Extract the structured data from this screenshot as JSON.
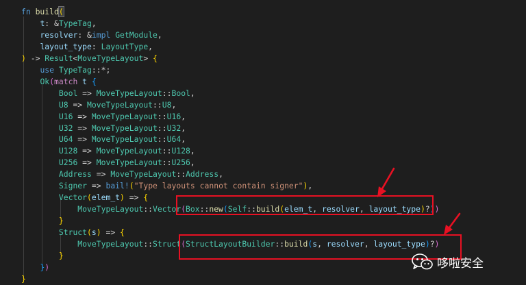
{
  "colors": {
    "background": "#1e1e1e",
    "keyword": "#569cd6",
    "control_keyword": "#c586c0",
    "type": "#4ec9b0",
    "function": "#dcdcaa",
    "variable": "#9cdcfe",
    "string": "#ce9178",
    "plain": "#d4d4d4",
    "bracket_level1": "#ffd700",
    "bracket_level2": "#da70d6",
    "bracket_level3": "#179fff",
    "annotation_red": "#e81123"
  },
  "code_lines": [
    [
      [
        "kw",
        "fn"
      ],
      [
        "pl",
        " "
      ],
      [
        "fn",
        "build"
      ],
      [
        "cur",
        "("
      ]
    ],
    [
      [
        "pl",
        "    "
      ],
      [
        "var",
        "t"
      ],
      [
        "pl",
        ": &"
      ],
      [
        "type",
        "TypeTag"
      ],
      [
        "pl",
        ","
      ]
    ],
    [
      [
        "pl",
        "    "
      ],
      [
        "var",
        "resolver"
      ],
      [
        "pl",
        ": &"
      ],
      [
        "kw",
        "impl"
      ],
      [
        "pl",
        " "
      ],
      [
        "type",
        "GetModule"
      ],
      [
        "pl",
        ","
      ]
    ],
    [
      [
        "pl",
        "    "
      ],
      [
        "var",
        "layout_type"
      ],
      [
        "pl",
        ": "
      ],
      [
        "type",
        "LayoutType"
      ],
      [
        "pl",
        ","
      ]
    ],
    [
      [
        "p1",
        ")"
      ],
      [
        "pl",
        " -> "
      ],
      [
        "type",
        "Result"
      ],
      [
        "pl",
        "<"
      ],
      [
        "type",
        "MoveTypeLayout"
      ],
      [
        "pl",
        "> "
      ],
      [
        "p1",
        "{"
      ]
    ],
    [
      [
        "pl",
        "    "
      ],
      [
        "kw",
        "use"
      ],
      [
        "pl",
        " "
      ],
      [
        "type",
        "TypeTag"
      ],
      [
        "pl",
        "::*;"
      ]
    ],
    [
      [
        "pl",
        "    "
      ],
      [
        "type",
        "Ok"
      ],
      [
        "p2",
        "("
      ],
      [
        "ctl",
        "match"
      ],
      [
        "pl",
        " "
      ],
      [
        "var",
        "t"
      ],
      [
        "pl",
        " "
      ],
      [
        "p3",
        "{"
      ]
    ],
    [
      [
        "pl",
        "        "
      ],
      [
        "type",
        "Bool"
      ],
      [
        "pl",
        " => "
      ],
      [
        "type",
        "MoveTypeLayout"
      ],
      [
        "pl",
        "::"
      ],
      [
        "type",
        "Bool"
      ],
      [
        "pl",
        ","
      ]
    ],
    [
      [
        "pl",
        "        "
      ],
      [
        "type",
        "U8"
      ],
      [
        "pl",
        " => "
      ],
      [
        "type",
        "MoveTypeLayout"
      ],
      [
        "pl",
        "::"
      ],
      [
        "type",
        "U8"
      ],
      [
        "pl",
        ","
      ]
    ],
    [
      [
        "pl",
        "        "
      ],
      [
        "type",
        "U16"
      ],
      [
        "pl",
        " => "
      ],
      [
        "type",
        "MoveTypeLayout"
      ],
      [
        "pl",
        "::"
      ],
      [
        "type",
        "U16"
      ],
      [
        "pl",
        ","
      ]
    ],
    [
      [
        "pl",
        "        "
      ],
      [
        "type",
        "U32"
      ],
      [
        "pl",
        " => "
      ],
      [
        "type",
        "MoveTypeLayout"
      ],
      [
        "pl",
        "::"
      ],
      [
        "type",
        "U32"
      ],
      [
        "pl",
        ","
      ]
    ],
    [
      [
        "pl",
        "        "
      ],
      [
        "type",
        "U64"
      ],
      [
        "pl",
        " => "
      ],
      [
        "type",
        "MoveTypeLayout"
      ],
      [
        "pl",
        "::"
      ],
      [
        "type",
        "U64"
      ],
      [
        "pl",
        ","
      ]
    ],
    [
      [
        "pl",
        "        "
      ],
      [
        "type",
        "U128"
      ],
      [
        "pl",
        " => "
      ],
      [
        "type",
        "MoveTypeLayout"
      ],
      [
        "pl",
        "::"
      ],
      [
        "type",
        "U128"
      ],
      [
        "pl",
        ","
      ]
    ],
    [
      [
        "pl",
        "        "
      ],
      [
        "type",
        "U256"
      ],
      [
        "pl",
        " => "
      ],
      [
        "type",
        "MoveTypeLayout"
      ],
      [
        "pl",
        "::"
      ],
      [
        "type",
        "U256"
      ],
      [
        "pl",
        ","
      ]
    ],
    [
      [
        "pl",
        "        "
      ],
      [
        "type",
        "Address"
      ],
      [
        "pl",
        " => "
      ],
      [
        "type",
        "MoveTypeLayout"
      ],
      [
        "pl",
        "::"
      ],
      [
        "type",
        "Address"
      ],
      [
        "pl",
        ","
      ]
    ],
    [
      [
        "pl",
        "        "
      ],
      [
        "type",
        "Signer"
      ],
      [
        "pl",
        " => "
      ],
      [
        "mac",
        "bail!"
      ],
      [
        "p1",
        "("
      ],
      [
        "str",
        "\"Type layouts cannot contain signer\""
      ],
      [
        "p1",
        ")"
      ],
      [
        "pl",
        ","
      ]
    ],
    [
      [
        "pl",
        "        "
      ],
      [
        "type",
        "Vector"
      ],
      [
        "p1",
        "("
      ],
      [
        "var",
        "elem_t"
      ],
      [
        "p1",
        ")"
      ],
      [
        "pl",
        " => "
      ],
      [
        "p1",
        "{"
      ]
    ],
    [
      [
        "pl",
        "            "
      ],
      [
        "type",
        "MoveTypeLayout"
      ],
      [
        "pl",
        "::"
      ],
      [
        "type",
        "Vector"
      ],
      [
        "p2",
        "("
      ],
      [
        "type",
        "Box"
      ],
      [
        "pl",
        "::"
      ],
      [
        "fn",
        "new"
      ],
      [
        "p3",
        "("
      ],
      [
        "type",
        "Self"
      ],
      [
        "pl",
        "::"
      ],
      [
        "fn",
        "build"
      ],
      [
        "p1",
        "("
      ],
      [
        "var",
        "elem_t"
      ],
      [
        "pl",
        ", "
      ],
      [
        "var",
        "resolver"
      ],
      [
        "pl",
        ", "
      ],
      [
        "var",
        "layout_type"
      ],
      [
        "p1",
        ")"
      ],
      [
        "pl",
        "?"
      ],
      [
        "p3",
        ")"
      ],
      [
        "p2",
        ")"
      ]
    ],
    [
      [
        "pl",
        "        "
      ],
      [
        "p1",
        "}"
      ]
    ],
    [
      [
        "pl",
        "        "
      ],
      [
        "type",
        "Struct"
      ],
      [
        "p1",
        "("
      ],
      [
        "var",
        "s"
      ],
      [
        "p1",
        ")"
      ],
      [
        "pl",
        " => "
      ],
      [
        "p1",
        "{"
      ]
    ],
    [
      [
        "pl",
        "            "
      ],
      [
        "type",
        "MoveTypeLayout"
      ],
      [
        "pl",
        "::"
      ],
      [
        "type",
        "Struct"
      ],
      [
        "p2",
        "("
      ],
      [
        "type",
        "StructLayoutBuilder"
      ],
      [
        "pl",
        "::"
      ],
      [
        "fn",
        "build"
      ],
      [
        "p3",
        "("
      ],
      [
        "var",
        "s"
      ],
      [
        "pl",
        ", "
      ],
      [
        "var",
        "resolver"
      ],
      [
        "pl",
        ", "
      ],
      [
        "var",
        "layout_type"
      ],
      [
        "p3",
        ")"
      ],
      [
        "pl",
        "?"
      ],
      [
        "p2",
        ")"
      ]
    ],
    [
      [
        "pl",
        "        "
      ],
      [
        "p1",
        "}"
      ]
    ],
    [
      [
        "pl",
        "    "
      ],
      [
        "p3",
        "}"
      ],
      [
        "p2",
        ")"
      ]
    ],
    [
      [
        "p1",
        "}"
      ]
    ]
  ],
  "watermark": {
    "text": "哆啦安全",
    "icon": "wechat-icon"
  }
}
